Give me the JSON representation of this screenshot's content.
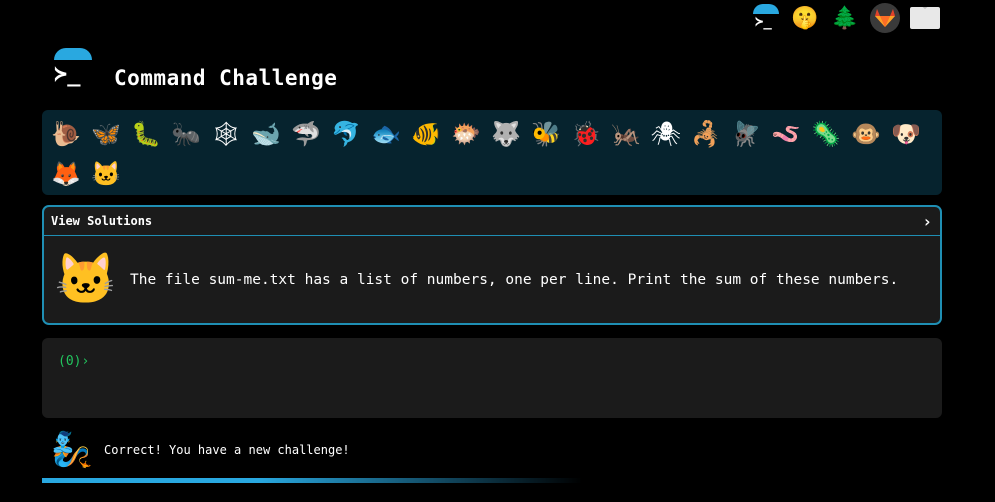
{
  "app": {
    "title": "Command Challenge"
  },
  "topbar": {
    "icons": [
      {
        "name": "terminal-icon",
        "glyph": ">_"
      },
      {
        "name": "shushing-face-icon",
        "glyph": "🤫"
      },
      {
        "name": "evergreen-tree-icon",
        "glyph": "🌲"
      },
      {
        "name": "gitlab-icon",
        "glyph": "🦊"
      },
      {
        "name": "envelope-icon",
        "glyph": ""
      }
    ]
  },
  "header": {
    "logo_glyph": "≻"
  },
  "animals": [
    {
      "name": "snail",
      "glyph": "🐌"
    },
    {
      "name": "butterfly",
      "glyph": "🦋"
    },
    {
      "name": "bug",
      "glyph": "🐛"
    },
    {
      "name": "ant",
      "glyph": "🐜"
    },
    {
      "name": "spider-web",
      "glyph": "🕸"
    },
    {
      "name": "whale",
      "glyph": "🐋"
    },
    {
      "name": "shark",
      "glyph": "🦈"
    },
    {
      "name": "dolphin",
      "glyph": "🐬"
    },
    {
      "name": "fish",
      "glyph": "🐟"
    },
    {
      "name": "tropical-fish",
      "glyph": "🐠"
    },
    {
      "name": "pufferfish",
      "glyph": "🐡"
    },
    {
      "name": "wolf",
      "glyph": "🐺"
    },
    {
      "name": "bee",
      "glyph": "🐝"
    },
    {
      "name": "lady-beetle",
      "glyph": "🐞"
    },
    {
      "name": "cricket",
      "glyph": "🦗"
    },
    {
      "name": "spider",
      "glyph": "🕷"
    },
    {
      "name": "scorpion",
      "glyph": "🦂"
    },
    {
      "name": "fly",
      "glyph": "🪰"
    },
    {
      "name": "worm",
      "glyph": "🪱"
    },
    {
      "name": "microbe",
      "glyph": "🦠"
    },
    {
      "name": "monkey",
      "glyph": "🐵"
    },
    {
      "name": "dog",
      "glyph": "🐶"
    },
    {
      "name": "fox",
      "glyph": "🦊"
    },
    {
      "name": "cat",
      "glyph": "🐱"
    }
  ],
  "challenge": {
    "solutions_label": "View Solutions",
    "chevron": "›",
    "pic_glyph": "🐱",
    "text": "The file sum-me.txt has a list of numbers, one per line. Print the sum of these numbers."
  },
  "terminal": {
    "prompt": "(0)›",
    "input_value": ""
  },
  "status": {
    "genie_glyph": "🧞",
    "message": "Correct! You have a new challenge!"
  },
  "progress": {
    "fraction": 0.6,
    "color": "#29a8e0"
  },
  "colors": {
    "accent": "#29a8e0",
    "prompt_green": "#22c55e",
    "panel_bg": "#1b1b1b",
    "animals_bg": "#06232e"
  }
}
